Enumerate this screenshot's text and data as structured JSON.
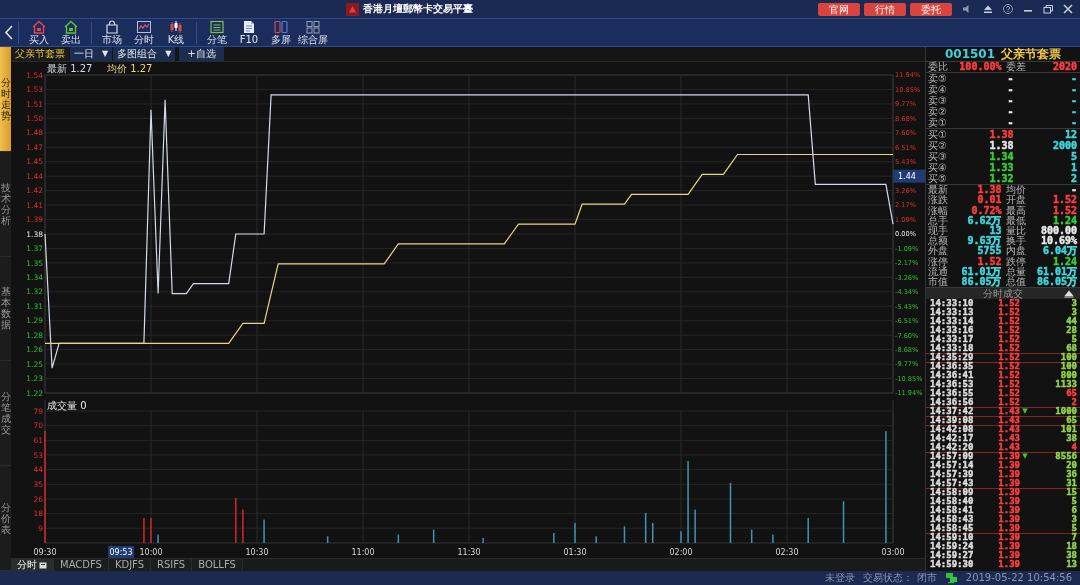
{
  "title_bar": {
    "title": "香港月壇郵幣卡交易平臺",
    "buttons": [
      "官网",
      "行情",
      "委托"
    ]
  },
  "toolbar": {
    "groups": [
      [
        {
          "label": "买入",
          "kind": "buy"
        },
        {
          "label": "卖出",
          "kind": "sell"
        }
      ],
      [
        {
          "label": "市场",
          "kind": "market"
        },
        {
          "label": "分时",
          "kind": "intraday"
        },
        {
          "label": "K线",
          "kind": "kline"
        }
      ],
      [
        {
          "label": "分笔",
          "kind": "ticks"
        },
        {
          "label": "F10",
          "kind": "f10"
        },
        {
          "label": "多屏",
          "kind": "multi"
        },
        {
          "label": "综合屏",
          "kind": "grid"
        }
      ]
    ]
  },
  "side_tabs": [
    {
      "label": "分时走势",
      "selected": true
    },
    {
      "label": "技术分析",
      "selected": false
    },
    {
      "label": "基本数据",
      "selected": false
    },
    {
      "label": "分笔成交",
      "selected": false
    },
    {
      "label": "分价表",
      "selected": false
    }
  ],
  "chart_header": {
    "name": "父亲节套票",
    "dropdowns": [
      {
        "value": "一日",
        "caret": "▼"
      },
      {
        "value": "多图组合",
        "caret": "▼"
      }
    ],
    "add_watch": "+自选"
  },
  "price_chart": {
    "legend": [
      {
        "value": "1.27"
      },
      {
        "value": "1.27"
      }
    ],
    "right_axis": [
      {
        "label": "11.94%"
      },
      {
        "label": "10.85%"
      },
      {
        "label": "9.77%"
      },
      {
        "label": "8.68%"
      },
      {
        "label": "7.60%"
      },
      {
        "label": "6.51%"
      },
      {
        "label": "5.43%"
      },
      {
        "label": "1.44",
        "kind": "cursor"
      },
      {
        "label": "3.26%"
      },
      {
        "label": "2.17%"
      },
      {
        "label": "1.09%"
      },
      {
        "label": "0.00%"
      },
      {
        "label": "-1.09%"
      },
      {
        "label": "-2.17%"
      },
      {
        "label": "-3.26%"
      },
      {
        "label": "-4.34%"
      },
      {
        "label": "-5.43%"
      },
      {
        "label": "-6.51%"
      },
      {
        "label": "-7.60%"
      },
      {
        "label": "-8.68%"
      },
      {
        "label": "-9.77%"
      },
      {
        "label": "-10.85%"
      },
      {
        "label": "-11.94%"
      }
    ],
    "chart_data": {
      "type": "line",
      "grid": true,
      "ylim": [
        1.22,
        1.54
      ],
      "categories": [
        null,
        null,
        null,
        null,
        null,
        null,
        null,
        null,
        null,
        null,
        null,
        null,
        null,
        null,
        null,
        null,
        null,
        null,
        null,
        null,
        null,
        null,
        null,
        null,
        null,
        null,
        null,
        null,
        null,
        null,
        null,
        null,
        null,
        null,
        null,
        null,
        null,
        null,
        null,
        null,
        null,
        null,
        null,
        null,
        null,
        null,
        null,
        null,
        null,
        null,
        null,
        null,
        null,
        null,
        null,
        null,
        null,
        null,
        null,
        null,
        null,
        null,
        null,
        null,
        null,
        null,
        null,
        null,
        null,
        null,
        null,
        null,
        null,
        null,
        null,
        null,
        null,
        null,
        null,
        null,
        null,
        null,
        null,
        null,
        null,
        null,
        null,
        null,
        null,
        null,
        null,
        null,
        null,
        null,
        null,
        null,
        null,
        null,
        null,
        null,
        null,
        null,
        null,
        null,
        null,
        null,
        null,
        null,
        null,
        null,
        null,
        null,
        null,
        null,
        null,
        null,
        null,
        null,
        null,
        null,
        null
      ],
      "yticks": [
        {
          "value": 1.54,
          "label": "1.54"
        },
        {
          "value": 1.5255,
          "label": "1.53"
        },
        {
          "value": 1.5109,
          "label": "1.51"
        },
        {
          "value": 1.4964,
          "label": "1.50"
        },
        {
          "value": 1.4818,
          "label": "1.48"
        },
        {
          "value": 1.4673,
          "label": "1.47"
        },
        {
          "value": 1.4527,
          "label": "1.45"
        },
        {
          "value": 1.4382,
          "label": "1.44"
        },
        {
          "value": 1.4236,
          "label": "1.42"
        },
        {
          "value": 1.4091,
          "label": "1.41"
        },
        {
          "value": 1.3945,
          "label": "1.39"
        },
        {
          "value": 1.38,
          "label": "1.38"
        },
        {
          "value": 1.3655,
          "label": "1.37"
        },
        {
          "value": 1.3509,
          "label": "1.35"
        },
        {
          "value": 1.3364,
          "label": "1.34"
        },
        {
          "value": 1.3218,
          "label": "1.32"
        },
        {
          "value": 1.3073,
          "label": "1.31"
        },
        {
          "value": 1.2927,
          "label": "1.29"
        },
        {
          "value": 1.2782,
          "label": "1.28"
        },
        {
          "value": 1.2636,
          "label": "1.26"
        },
        {
          "value": 1.2491,
          "label": "1.25"
        },
        {
          "value": 1.2345,
          "label": "1.23"
        },
        {
          "value": 1.22,
          "label": "1.22"
        }
      ],
      "series": [
        {
          "name": "最新",
          "color": "#d3dae8",
          "values": [
            1.38,
            1.245,
            1.27,
            1.27,
            1.27,
            1.27,
            1.27,
            1.27,
            1.27,
            1.27,
            1.27,
            1.27,
            1.27,
            1.27,
            1.27,
            1.505,
            1.32,
            1.515,
            1.32,
            1.32,
            1.32,
            1.33,
            1.33,
            1.33,
            1.33,
            1.33,
            1.33,
            1.38,
            1.38,
            1.38,
            1.38,
            1.38,
            1.52,
            1.52,
            1.52,
            1.52,
            1.52,
            1.52,
            1.52,
            1.52,
            1.52,
            1.52,
            1.52,
            1.52,
            1.52,
            1.52,
            1.52,
            1.52,
            1.52,
            1.52,
            1.52,
            1.52,
            1.52,
            1.52,
            1.52,
            1.52,
            1.52,
            1.52,
            1.52,
            1.52,
            1.52,
            1.52,
            1.52,
            1.52,
            1.52,
            1.52,
            1.52,
            1.52,
            1.52,
            1.52,
            1.52,
            1.52,
            1.52,
            1.52,
            1.52,
            1.52,
            1.52,
            1.52,
            1.52,
            1.52,
            1.52,
            1.52,
            1.52,
            1.52,
            1.52,
            1.52,
            1.52,
            1.52,
            1.52,
            1.52,
            1.52,
            1.52,
            1.52,
            1.52,
            1.52,
            1.52,
            1.52,
            1.52,
            1.52,
            1.52,
            1.52,
            1.52,
            1.52,
            1.52,
            1.52,
            1.52,
            1.52,
            1.52,
            1.52,
            1.43,
            1.43,
            1.43,
            1.43,
            1.43,
            1.43,
            1.43,
            1.43,
            1.43,
            1.43,
            1.43,
            1.39
          ]
        },
        {
          "name": "均价",
          "color": "#e6d68a",
          "values": [
            1.27,
            1.27,
            1.27,
            1.27,
            1.27,
            1.27,
            1.27,
            1.27,
            1.27,
            1.27,
            1.27,
            1.27,
            1.27,
            1.27,
            1.27,
            1.27,
            1.27,
            1.27,
            1.27,
            1.27,
            1.27,
            1.27,
            1.27,
            1.27,
            1.27,
            1.27,
            1.27,
            1.28,
            1.29,
            1.29,
            1.29,
            1.29,
            1.32,
            1.35,
            1.35,
            1.35,
            1.35,
            1.35,
            1.35,
            1.35,
            1.35,
            1.35,
            1.35,
            1.35,
            1.35,
            1.35,
            1.35,
            1.35,
            1.35,
            1.36,
            1.37,
            1.37,
            1.37,
            1.37,
            1.37,
            1.37,
            1.37,
            1.37,
            1.37,
            1.37,
            1.37,
            1.37,
            1.37,
            1.37,
            1.37,
            1.37,
            1.38,
            1.39,
            1.39,
            1.39,
            1.39,
            1.39,
            1.39,
            1.39,
            1.39,
            1.39,
            1.41,
            1.41,
            1.41,
            1.41,
            1.41,
            1.41,
            1.41,
            1.42,
            1.42,
            1.42,
            1.42,
            1.42,
            1.42,
            1.42,
            1.42,
            1.42,
            1.43,
            1.44,
            1.44,
            1.44,
            1.44,
            1.45,
            1.46,
            1.46,
            1.46,
            1.46,
            1.46,
            1.46,
            1.46,
            1.46,
            1.46,
            1.46,
            1.46,
            1.46,
            1.46,
            1.46,
            1.46,
            1.46,
            1.46,
            1.46,
            1.46,
            1.46,
            1.46,
            1.46,
            1.46
          ]
        }
      ]
    }
  },
  "volume_chart": {
    "legend": {
      "label": "成交量",
      "value": "0"
    },
    "cursor_time": "09:53",
    "chart_data": {
      "type": "bar",
      "grid": true,
      "ylim": [
        0,
        79
      ],
      "categories": [
        "09:30",
        null,
        null,
        null,
        null,
        null,
        null,
        null,
        null,
        null,
        null,
        null,
        null,
        null,
        null,
        "10:00",
        null,
        null,
        null,
        null,
        null,
        null,
        null,
        null,
        null,
        null,
        null,
        null,
        null,
        null,
        "10:30",
        null,
        null,
        null,
        null,
        null,
        null,
        null,
        null,
        null,
        null,
        null,
        null,
        null,
        null,
        "11:00",
        null,
        null,
        null,
        null,
        null,
        null,
        null,
        null,
        null,
        null,
        null,
        null,
        null,
        null,
        "11:30",
        null,
        null,
        null,
        null,
        null,
        null,
        null,
        null,
        null,
        null,
        null,
        null,
        null,
        null,
        "01:30",
        null,
        null,
        null,
        null,
        null,
        null,
        null,
        null,
        null,
        null,
        null,
        null,
        null,
        null,
        "02:00",
        null,
        null,
        null,
        null,
        null,
        null,
        null,
        null,
        null,
        null,
        null,
        null,
        null,
        null,
        "02:30",
        null,
        null,
        null,
        null,
        null,
        null,
        null,
        null,
        null,
        null,
        null,
        null,
        null,
        null,
        "03:00"
      ],
      "yticks": [
        {
          "value": 79,
          "label": "79"
        },
        {
          "value": 70.2,
          "label": "70"
        },
        {
          "value": 61.4,
          "label": "61"
        },
        {
          "value": 52.7,
          "label": "53"
        },
        {
          "value": 43.9,
          "label": "44"
        },
        {
          "value": 35.1,
          "label": "35"
        },
        {
          "value": 26.3,
          "label": "26"
        },
        {
          "value": 17.6,
          "label": "18"
        },
        {
          "value": 8.8,
          "label": "9"
        }
      ],
      "series": [
        {
          "color": "#d02a2a",
          "values": [
            67,
            null,
            null,
            null,
            null,
            null,
            null,
            null,
            null,
            null,
            null,
            null,
            null,
            null,
            15,
            15,
            null,
            null,
            null,
            null,
            null,
            null,
            null,
            null,
            null,
            null,
            null,
            27,
            20,
            null,
            null,
            null,
            null,
            null,
            null,
            null,
            null,
            null,
            null,
            null,
            null,
            null,
            null,
            null,
            null,
            null,
            null,
            null,
            null,
            null,
            null,
            null,
            null,
            null,
            null,
            null,
            null,
            null,
            null,
            null,
            null,
            null,
            null,
            null,
            null,
            null,
            null,
            null,
            null,
            null,
            null,
            null,
            null,
            null,
            null,
            null,
            null,
            null,
            null,
            null,
            null,
            null,
            null,
            null,
            null,
            null,
            null,
            null,
            null,
            null,
            null,
            null,
            null,
            null,
            null,
            null,
            null,
            null,
            null,
            null,
            null,
            null,
            null,
            null,
            null,
            null,
            null,
            null,
            null,
            null,
            null,
            null,
            null,
            null,
            null,
            null,
            null,
            null,
            null,
            null,
            null
          ]
        },
        {
          "color": "#3f93b4",
          "values": [
            null,
            null,
            null,
            null,
            null,
            null,
            null,
            null,
            null,
            null,
            null,
            null,
            null,
            null,
            null,
            null,
            5,
            null,
            null,
            null,
            null,
            null,
            null,
            null,
            null,
            null,
            null,
            null,
            null,
            null,
            null,
            14,
            null,
            null,
            null,
            null,
            null,
            null,
            null,
            null,
            4,
            null,
            null,
            null,
            null,
            null,
            null,
            null,
            null,
            null,
            5,
            null,
            null,
            null,
            null,
            8,
            null,
            null,
            null,
            null,
            null,
            null,
            3,
            null,
            null,
            null,
            null,
            null,
            null,
            null,
            null,
            null,
            6,
            null,
            null,
            12,
            null,
            null,
            4,
            null,
            null,
            null,
            10,
            null,
            null,
            18,
            12,
            null,
            null,
            null,
            7,
            49,
            20,
            null,
            null,
            null,
            null,
            36,
            null,
            null,
            8,
            null,
            null,
            5,
            null,
            null,
            null,
            null,
            15,
            null,
            null,
            null,
            null,
            25,
            null,
            null,
            null,
            null,
            null,
            67,
            null
          ]
        }
      ]
    }
  },
  "bottom_tabs": [
    {
      "label": "分时",
      "selected": true,
      "menu": true
    },
    {
      "label": "MACDFS",
      "selected": false,
      "menu": false
    },
    {
      "label": "KDJFS",
      "selected": false,
      "menu": false
    },
    {
      "label": "RSIFS",
      "selected": false,
      "menu": false
    },
    {
      "label": "BOLLFS",
      "selected": false,
      "menu": false
    }
  ],
  "quote": {
    "code": "001501",
    "name": "父亲节套票",
    "ratio": [
      {
        "label": "委比",
        "value": "100.00%",
        "color": "#ff3d3d"
      },
      {
        "label": "委差",
        "value": "2020",
        "color": "#ff3d3d"
      }
    ],
    "asks": [
      {
        "label": "卖⑤",
        "price": "-",
        "volume": "-"
      },
      {
        "label": "卖④",
        "price": "-",
        "volume": "-"
      },
      {
        "label": "卖③",
        "price": "-",
        "volume": "-"
      },
      {
        "label": "卖②",
        "price": "-",
        "volume": "-"
      },
      {
        "label": "卖①",
        "price": "-",
        "volume": "-"
      }
    ],
    "bids": [
      {
        "label": "买①",
        "price": {
          "text": "1.38",
          "color": "#ff3d3d"
        },
        "volume": {
          "text": "12",
          "color": "#3fd6dc"
        }
      },
      {
        "label": "买②",
        "price": {
          "text": "1.38",
          "color": "#e8e8e8"
        },
        "volume": {
          "text": "2000",
          "color": "#3fd6dc"
        }
      },
      {
        "label": "买③",
        "price": {
          "text": "1.34",
          "color": "#35d035"
        },
        "volume": {
          "text": "5",
          "color": "#3fd6dc"
        }
      },
      {
        "label": "买④",
        "price": {
          "text": "1.33",
          "color": "#35d035"
        },
        "volume": {
          "text": "1",
          "color": "#3fd6dc"
        }
      },
      {
        "label": "买⑤",
        "price": {
          "text": "1.32",
          "color": "#35d035"
        },
        "volume": {
          "text": "2",
          "color": "#3fd6dc"
        }
      }
    ],
    "stats": [
      {
        "label": "最新",
        "value": "1.38",
        "color": "#ff3d3d"
      },
      {
        "label": "均价",
        "value": "-"
      },
      {
        "label": "涨跌",
        "value": "0.01",
        "color": "#ff3d3d"
      },
      {
        "label": "开盘",
        "value": "1.52",
        "color": "#ff3d3d"
      },
      {
        "label": "涨幅",
        "value": "0.72%",
        "color": "#ff3d3d"
      },
      {
        "label": "最高",
        "value": "1.52",
        "color": "#ff3d3d"
      },
      {
        "label": "总手",
        "value": "6.62万",
        "color": "#3fd6dc"
      },
      {
        "label": "最低",
        "value": "1.24",
        "color": "#35d035"
      },
      {
        "label": "现手",
        "value": "13",
        "color": "#3fd6dc"
      },
      {
        "label": "量比",
        "value": "800.00",
        "color": "#e8e8e8"
      },
      {
        "label": "总额",
        "value": "9.63万",
        "color": "#3fd6dc"
      },
      {
        "label": "换手",
        "value": "10.69%",
        "color": "#e8e8e8"
      },
      {
        "label": "外盘",
        "value": "5755",
        "color": "#3fd6dc"
      },
      {
        "label": "内盘",
        "value": "6.04万",
        "color": "#3fd6dc"
      },
      {
        "label": "涨停",
        "value": "1.52",
        "color": "#ff3d3d"
      },
      {
        "label": "跌停",
        "value": "1.24",
        "color": "#35d035"
      },
      {
        "label": "流通",
        "value": "61.01万",
        "color": "#3fd6dc"
      },
      {
        "label": "总量",
        "value": "61.01万",
        "color": "#3fd6dc"
      },
      {
        "label": "市值",
        "value": "86.05万",
        "color": "#3fd6dc"
      },
      {
        "label": "总值",
        "value": "86.05万",
        "color": "#3fd6dc"
      }
    ]
  },
  "trades": {
    "title": "分时成交",
    "rows": [
      {
        "time": "14:33:10",
        "price": "1.52",
        "volume": {
          "text": "3",
          "color": "#8fd24a"
        },
        "group_start": false
      },
      {
        "time": "14:33:13",
        "price": "1.52",
        "volume": {
          "text": "3",
          "color": "#8fd24a"
        },
        "group_start": false
      },
      {
        "time": "14:33:14",
        "price": "1.52",
        "volume": {
          "text": "44",
          "color": "#8fd24a"
        },
        "group_start": false
      },
      {
        "time": "14:33:16",
        "price": "1.52",
        "volume": {
          "text": "28",
          "color": "#8fd24a"
        },
        "group_start": false
      },
      {
        "time": "14:33:17",
        "price": "1.52",
        "volume": {
          "text": "5",
          "color": "#8fd24a"
        },
        "group_start": false
      },
      {
        "time": "14:33:18",
        "price": "1.52",
        "volume": {
          "text": "68",
          "color": "#8fd24a"
        },
        "group_start": false
      },
      {
        "time": "14:35:29",
        "price": "1.52",
        "volume": {
          "text": "100",
          "color": "#8fd24a"
        },
        "group_start": true
      },
      {
        "time": "14:36:35",
        "price": "1.52",
        "volume": {
          "text": "100",
          "color": "#8fd24a"
        },
        "group_start": true
      },
      {
        "time": "14:36:41",
        "price": "1.52",
        "volume": {
          "text": "800",
          "color": "#8fd24a"
        },
        "group_start": false
      },
      {
        "time": "14:36:53",
        "price": "1.52",
        "volume": {
          "text": "1133",
          "color": "#8fd24a"
        },
        "group_start": false
      },
      {
        "time": "14:36:55",
        "price": "1.52",
        "volume": {
          "text": "65",
          "color": "#ff3d3d"
        },
        "group_start": false
      },
      {
        "time": "14:36:56",
        "price": "1.52",
        "volume": {
          "text": "2",
          "color": "#ff3d3d"
        },
        "group_start": false
      },
      {
        "time": "14:37:42",
        "price": "1.43",
        "mark": "▼",
        "volume": {
          "text": "1000",
          "color": "#8fd24a"
        },
        "group_start": true
      },
      {
        "time": "14:39:08",
        "price": "1.43",
        "volume": {
          "text": "65",
          "color": "#8fd24a"
        },
        "group_start": true
      },
      {
        "time": "14:42:08",
        "price": "1.43",
        "volume": {
          "text": "101",
          "color": "#8fd24a"
        },
        "group_start": true
      },
      {
        "time": "14:42:17",
        "price": "1.43",
        "volume": {
          "text": "38",
          "color": "#8fd24a"
        },
        "group_start": false
      },
      {
        "time": "14:42:20",
        "price": "1.43",
        "volume": {
          "text": "4",
          "color": "#ff3d3d"
        },
        "group_start": false
      },
      {
        "time": "14:57:09",
        "price": "1.39",
        "mark": "▼",
        "volume": {
          "text": "8556",
          "color": "#8fd24a"
        },
        "group_start": true
      },
      {
        "time": "14:57:14",
        "price": "1.39",
        "volume": {
          "text": "20",
          "color": "#8fd24a"
        },
        "group_start": false
      },
      {
        "time": "14:57:39",
        "price": "1.39",
        "volume": {
          "text": "36",
          "color": "#8fd24a"
        },
        "group_start": false
      },
      {
        "time": "14:57:43",
        "price": "1.39",
        "volume": {
          "text": "31",
          "color": "#8fd24a"
        },
        "group_start": false
      },
      {
        "time": "14:58:09",
        "price": "1.39",
        "volume": {
          "text": "15",
          "color": "#8fd24a"
        },
        "group_start": true
      },
      {
        "time": "14:58:40",
        "price": "1.39",
        "volume": {
          "text": "5",
          "color": "#8fd24a"
        },
        "group_start": false
      },
      {
        "time": "14:58:41",
        "price": "1.39",
        "volume": {
          "text": "6",
          "color": "#8fd24a"
        },
        "group_start": false
      },
      {
        "time": "14:58:43",
        "price": "1.39",
        "volume": {
          "text": "3",
          "color": "#8fd24a"
        },
        "group_start": false
      },
      {
        "time": "14:58:45",
        "price": "1.39",
        "volume": {
          "text": "5",
          "color": "#8fd24a"
        },
        "group_start": false
      },
      {
        "time": "14:59:10",
        "price": "1.39",
        "volume": {
          "text": "7",
          "color": "#8fd24a"
        },
        "group_start": true
      },
      {
        "time": "14:59:24",
        "price": "1.39",
        "volume": {
          "text": "18",
          "color": "#8fd24a"
        },
        "group_start": false
      },
      {
        "time": "14:59:27",
        "price": "1.39",
        "volume": {
          "text": "38",
          "color": "#8fd24a"
        },
        "group_start": false
      },
      {
        "time": "14:59:30",
        "price": "1.39",
        "volume": {
          "text": "13",
          "color": "#8fd24a"
        },
        "group_start": false
      }
    ]
  },
  "status_bar": {
    "login": "未登录",
    "state_label": "交易状态：",
    "state": "闭市",
    "datetime": "2019-05-22 10:54:56"
  }
}
